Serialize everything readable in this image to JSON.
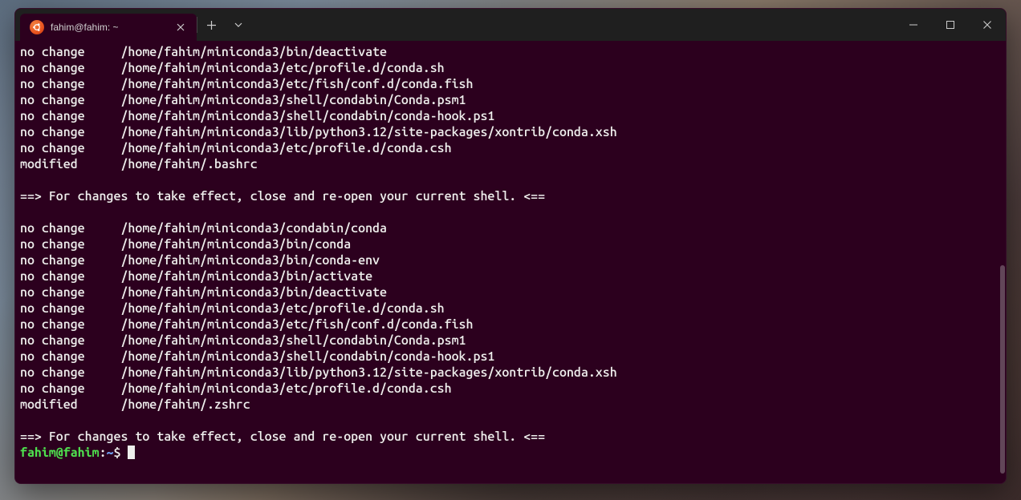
{
  "titlebar": {
    "tab_title": "fahim@fahim: ~",
    "tab_icon_name": "ubuntu-logo-icon"
  },
  "terminal": {
    "lines": [
      "no change     /home/fahim/miniconda3/bin/deactivate",
      "no change     /home/fahim/miniconda3/etc/profile.d/conda.sh",
      "no change     /home/fahim/miniconda3/etc/fish/conf.d/conda.fish",
      "no change     /home/fahim/miniconda3/shell/condabin/Conda.psm1",
      "no change     /home/fahim/miniconda3/shell/condabin/conda-hook.ps1",
      "no change     /home/fahim/miniconda3/lib/python3.12/site-packages/xontrib/conda.xsh",
      "no change     /home/fahim/miniconda3/etc/profile.d/conda.csh",
      "modified      /home/fahim/.bashrc",
      "",
      "==> For changes to take effect, close and re-open your current shell. <==",
      "",
      "no change     /home/fahim/miniconda3/condabin/conda",
      "no change     /home/fahim/miniconda3/bin/conda",
      "no change     /home/fahim/miniconda3/bin/conda-env",
      "no change     /home/fahim/miniconda3/bin/activate",
      "no change     /home/fahim/miniconda3/bin/deactivate",
      "no change     /home/fahim/miniconda3/etc/profile.d/conda.sh",
      "no change     /home/fahim/miniconda3/etc/fish/conf.d/conda.fish",
      "no change     /home/fahim/miniconda3/shell/condabin/Conda.psm1",
      "no change     /home/fahim/miniconda3/shell/condabin/conda-hook.ps1",
      "no change     /home/fahim/miniconda3/lib/python3.12/site-packages/xontrib/conda.xsh",
      "no change     /home/fahim/miniconda3/etc/profile.d/conda.csh",
      "modified      /home/fahim/.zshrc",
      "",
      "==> For changes to take effect, close and re-open your current shell. <=="
    ],
    "prompt": {
      "user_host": "fahim@fahim",
      "colon": ":",
      "path": "~",
      "dollar": "$ "
    }
  }
}
